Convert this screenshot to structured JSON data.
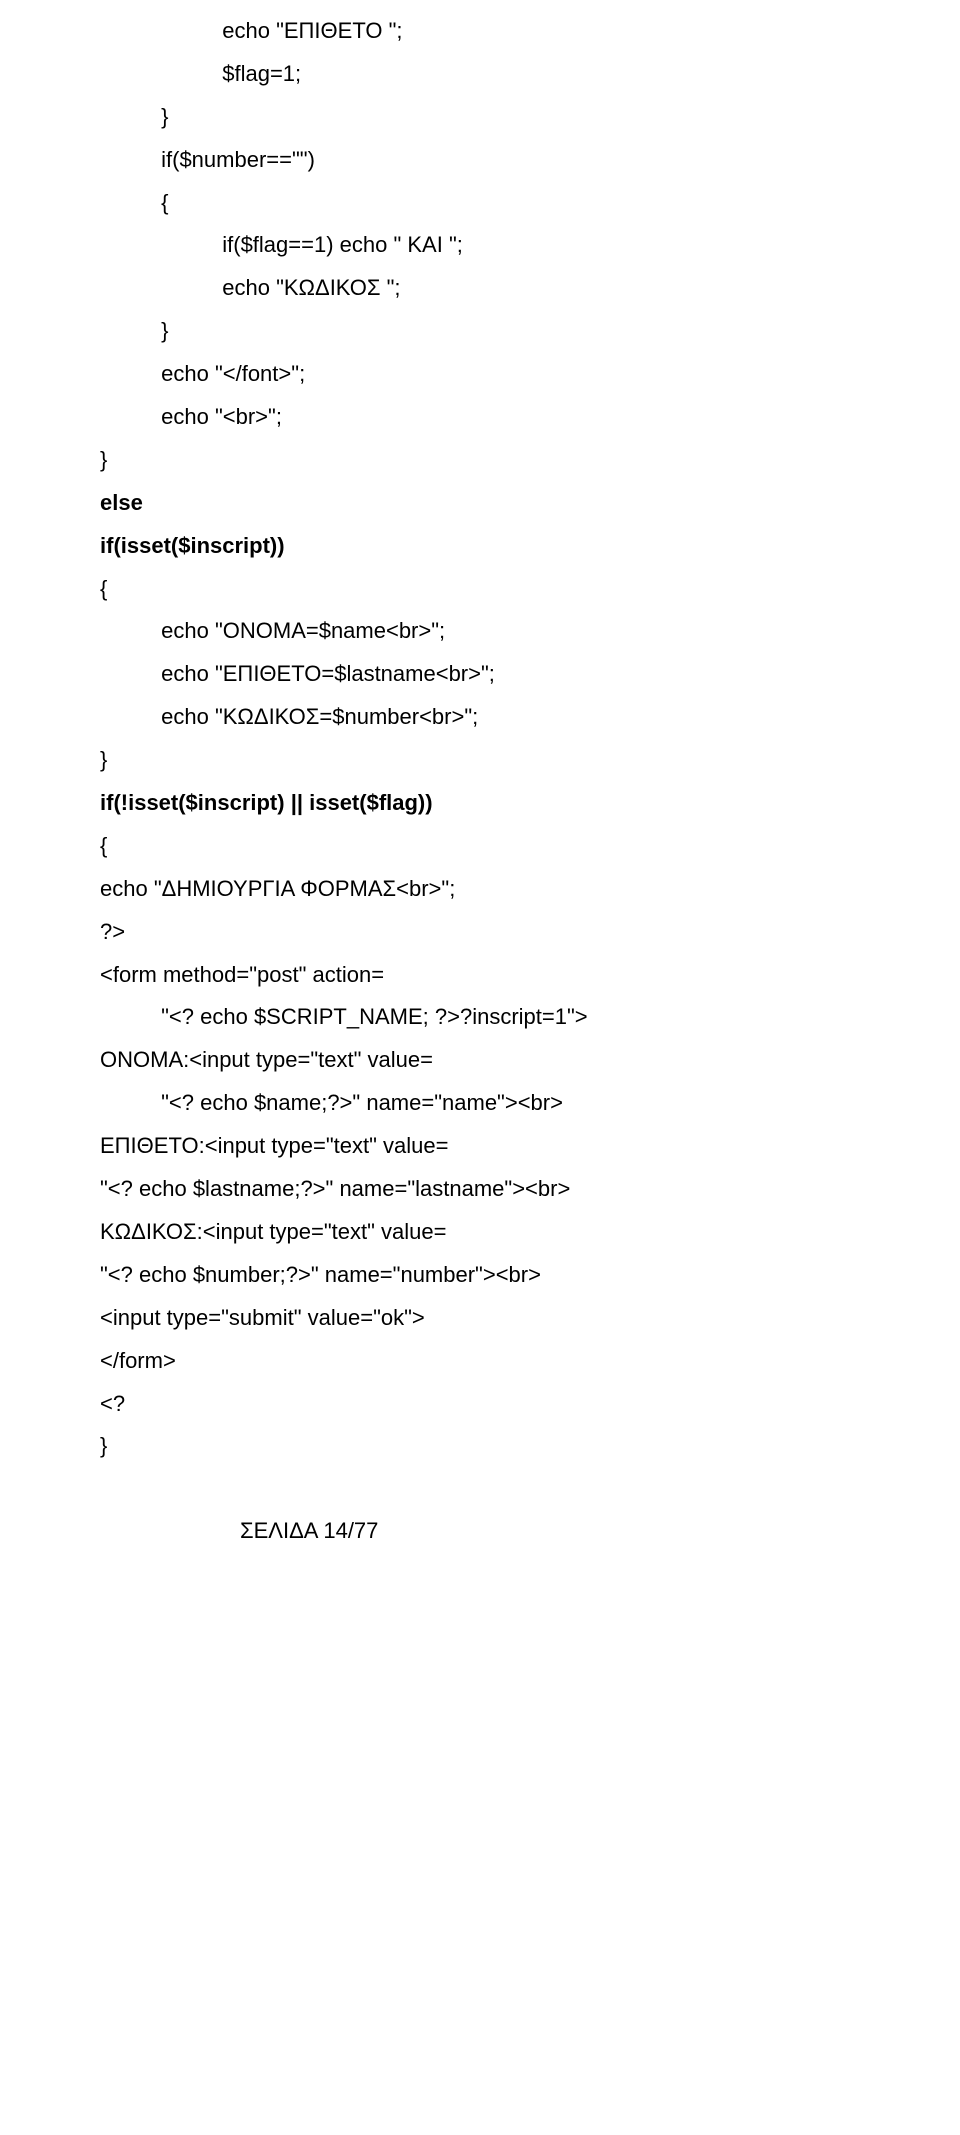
{
  "lines": [
    {
      "text": "                    echo \"ΕΠΙΘΕΤΟ \";",
      "bold": false
    },
    {
      "text": "                    $flag=1;",
      "bold": false
    },
    {
      "text": "          }",
      "bold": false
    },
    {
      "text": "          if($number==\"\")",
      "bold": false
    },
    {
      "text": "          {",
      "bold": false
    },
    {
      "text": "                    if($flag==1) echo \" ΚΑΙ \";",
      "bold": false
    },
    {
      "text": "                    echo \"ΚΩΔΙΚΟΣ \";",
      "bold": false
    },
    {
      "text": "          }",
      "bold": false
    },
    {
      "text": "          echo \"</font>\";",
      "bold": false
    },
    {
      "text": "          echo \"<br>\";",
      "bold": false
    },
    {
      "text": "}",
      "bold": false
    },
    {
      "text": "else",
      "bold": true
    },
    {
      "text": "if(isset($inscript))",
      "bold": true
    },
    {
      "text": "{",
      "bold": false
    },
    {
      "text": "          echo \"ΟΝΟΜΑ=$name<br>\";",
      "bold": false
    },
    {
      "text": "          echo \"ΕΠΙΘΕΤΟ=$lastname<br>\";",
      "bold": false
    },
    {
      "text": "          echo \"ΚΩΔΙΚΟΣ=$number<br>\";",
      "bold": false
    },
    {
      "text": "}",
      "bold": false
    },
    {
      "text": "if(!isset($inscript) || isset($flag))",
      "bold": true
    },
    {
      "text": "{",
      "bold": false
    },
    {
      "text": "echo \"ΔΗΜΙΟΥΡΓΙΑ ΦΟΡΜΑΣ<br>\";",
      "bold": false
    },
    {
      "text": "?>",
      "bold": false
    },
    {
      "text": "<form method=\"post\" action=",
      "bold": false
    },
    {
      "text": "          \"<? echo $SCRIPT_NAME; ?>?inscript=1\">",
      "bold": false
    },
    {
      "text": "ΟΝΟΜΑ:<input type=\"text\" value=",
      "bold": false
    },
    {
      "text": "          \"<? echo $name;?>\" name=\"name\"><br>",
      "bold": false
    },
    {
      "text": "ΕΠΙΘΕΤΟ:<input type=\"text\" value=",
      "bold": false
    },
    {
      "text": "\"<? echo $lastname;?>\" name=\"lastname\"><br>",
      "bold": false
    },
    {
      "text": "ΚΩΔΙΚΟΣ:<input type=\"text\" value=",
      "bold": false
    },
    {
      "text": "\"<? echo $number;?>\" name=\"number\"><br>",
      "bold": false
    },
    {
      "text": "<input type=\"submit\" value=\"ok\">",
      "bold": false
    },
    {
      "text": "</form>",
      "bold": false
    },
    {
      "text": "<?",
      "bold": false
    },
    {
      "text": "}",
      "bold": false
    }
  ],
  "footer": "ΣΕΛΙΔΑ 14/77"
}
